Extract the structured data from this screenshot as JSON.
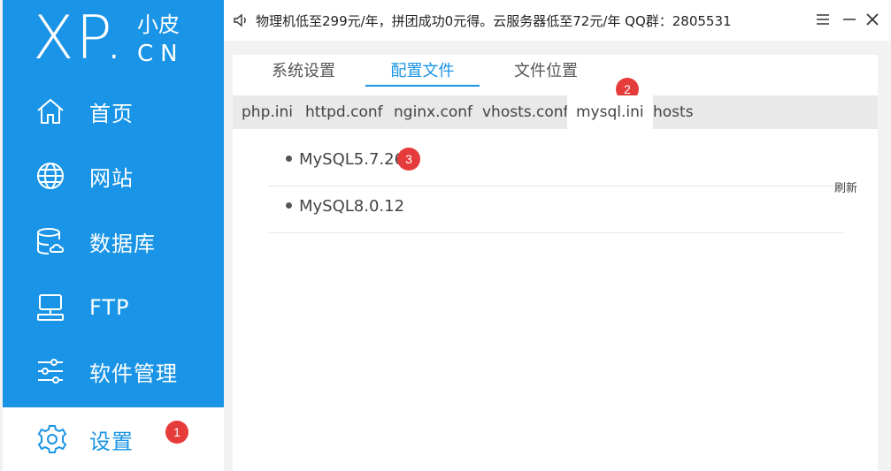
{
  "logo": {
    "xp": "XP.",
    "cn_top": "小皮",
    "cn_bottom": "CN"
  },
  "sidebar": {
    "items": [
      {
        "label": "首页",
        "icon": "home-icon"
      },
      {
        "label": "网站",
        "icon": "globe-icon"
      },
      {
        "label": "数据库",
        "icon": "database-icon"
      },
      {
        "label": "FTP",
        "icon": "ftp-icon"
      },
      {
        "label": "软件管理",
        "icon": "sliders-icon"
      },
      {
        "label": "设置",
        "icon": "gear-icon",
        "active": true
      }
    ],
    "badge": "1"
  },
  "topbar": {
    "notice": "物理机低至299元/年，拼团成功0元得。云服务器低至72元/年  QQ群：2805531"
  },
  "tabs": {
    "items": [
      "系统设置",
      "配置文件",
      "文件位置"
    ],
    "active": 1
  },
  "badge2": "2",
  "subtabs": {
    "items": [
      "php.ini",
      "httpd.conf",
      "nginx.conf",
      "vhosts.conf",
      "mysql.ini",
      "hosts"
    ],
    "active": 4
  },
  "list": {
    "items": [
      "MySQL5.7.26",
      "MySQL8.0.12"
    ]
  },
  "badge3": "3",
  "refresh_label": "刷新",
  "colors": {
    "accent": "#1a94e6",
    "badge": "#e63b3b"
  }
}
